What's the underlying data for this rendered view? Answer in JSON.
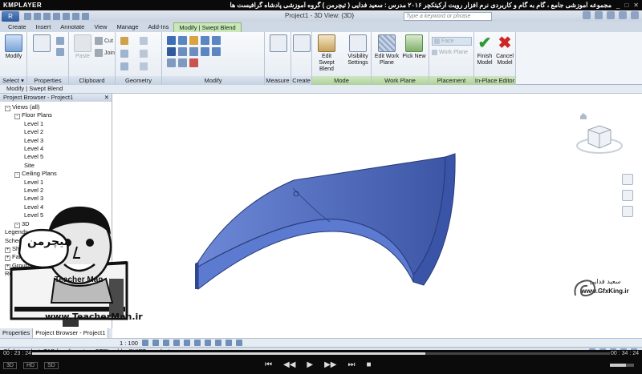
{
  "player": {
    "logo": "KMPLAYER",
    "title": "مجموعه آموزشی جامع ، گام به گام و کاربردی نرم افزار رویت آرکیتکچر ۲۰۱۶ مدرس : سعید فدایی ( تیچرمن ) گروه آموزشی پادشاه گرافیست ها",
    "time_elapsed": "00 : 23 : 24",
    "time_total": "00 : 34 : 24",
    "progress_fraction": 0.68,
    "volume_fraction": 0.65,
    "left_buttons": [
      "3D",
      "HD",
      "SD"
    ],
    "controls": [
      "⏮",
      "◀◀",
      "▶",
      "▶▶",
      "⏭",
      "■"
    ]
  },
  "app": {
    "app_button": "R",
    "doc_title": "Project1 - 3D View: {3D}",
    "search_placeholder": "Type a keyword or phrase"
  },
  "tabs": [
    "Create",
    "Insert",
    "Annotate",
    "View",
    "Manage",
    "Add-Ins",
    "Modify | Swept Blend"
  ],
  "active_tab_index": 6,
  "ribbon": {
    "select": {
      "button": "Modify",
      "label": "Select ▾"
    },
    "properties": {
      "label": "Properties"
    },
    "clipboard": {
      "paste": "Paste",
      "cut": "Cut",
      "join": "Join",
      "label": "Clipboard"
    },
    "geometry": {
      "label": "Geometry"
    },
    "modify": {
      "label": "Modify"
    },
    "measure": {
      "label": "Measure"
    },
    "create": {
      "label": "Create"
    },
    "mode": {
      "edit_swept_blend": "Edit Swept Blend",
      "visibility_settings": "Visibility Settings",
      "label": "Mode"
    },
    "work_plane": {
      "edit_work_plane": "Edit Work Plane",
      "pick_new": "Pick New",
      "label": "Work Plane"
    },
    "placement": {
      "face": "Face",
      "work_plane": "Work Plane",
      "label": "Placement"
    },
    "in_place_editor": {
      "finish_model": "Finish Model",
      "cancel_model": "Cancel Model",
      "label": "In-Place Editor"
    }
  },
  "options_bar": "Modify | Swept Blend",
  "project_browser": {
    "title": "Project Browser - Project1",
    "tree": [
      {
        "text": "Views (all)",
        "depth": 0,
        "toggle": "-"
      },
      {
        "text": "Floor Plans",
        "depth": 1,
        "toggle": "-"
      },
      {
        "text": "Level 1",
        "depth": 2,
        "toggle": ""
      },
      {
        "text": "Level 2",
        "depth": 2,
        "toggle": ""
      },
      {
        "text": "Level 3",
        "depth": 2,
        "toggle": ""
      },
      {
        "text": "Level 4",
        "depth": 2,
        "toggle": ""
      },
      {
        "text": "Level 5",
        "depth": 2,
        "toggle": ""
      },
      {
        "text": "Site",
        "depth": 2,
        "toggle": ""
      },
      {
        "text": "Ceiling Plans",
        "depth": 1,
        "toggle": "-"
      },
      {
        "text": "Level 1",
        "depth": 2,
        "toggle": ""
      },
      {
        "text": "Level 2",
        "depth": 2,
        "toggle": ""
      },
      {
        "text": "Level 3",
        "depth": 2,
        "toggle": ""
      },
      {
        "text": "Level 4",
        "depth": 2,
        "toggle": ""
      },
      {
        "text": "Level 5",
        "depth": 2,
        "toggle": ""
      },
      {
        "text": "3D",
        "depth": 1,
        "toggle": "-"
      },
      {
        "text": "",
        "depth": 0,
        "toggle": ""
      },
      {
        "text": "",
        "depth": 0,
        "toggle": ""
      },
      {
        "text": "",
        "depth": 0,
        "toggle": ""
      },
      {
        "text": "",
        "depth": 0,
        "toggle": ""
      },
      {
        "text": "Legends",
        "depth": 0,
        "toggle": ""
      },
      {
        "text": "Schedules/Quantities",
        "depth": 0,
        "toggle": ""
      },
      {
        "text": "Sheets (all)",
        "depth": 0,
        "toggle": "+"
      },
      {
        "text": "Families",
        "depth": 0,
        "toggle": "+"
      },
      {
        "text": "Groups",
        "depth": 0,
        "toggle": "+"
      },
      {
        "text": "Revit Links",
        "depth": 0,
        "toggle": ""
      }
    ],
    "tabs": [
      "Properties",
      "Project Browser - Project1"
    ]
  },
  "watermark": {
    "brand_fa": "تیچرمن",
    "brand_en": "Teacher Man",
    "url": "www.TeacherMan.ir",
    "author_fa": "سعید فدایی",
    "site": "www.GfxKing.ir"
  },
  "view_control": {
    "scale": "1 : 100"
  },
  "status_bar": "Click to select, TAB for alternates, CTRL adds, SHIFT unselects.",
  "colors": {
    "ribbon_context": "#c8e8b8",
    "swept_blend_fill": "#5b7ad0",
    "swept_blend_dark": "#3a55a8"
  }
}
